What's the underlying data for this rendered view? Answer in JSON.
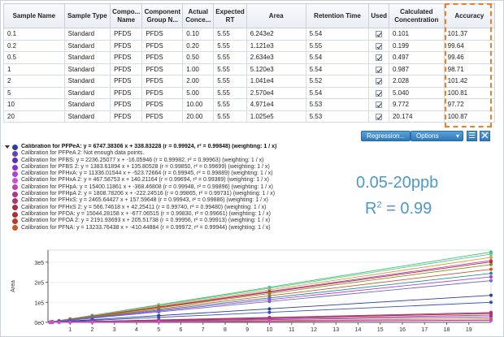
{
  "table": {
    "headers": [
      "Sample Name",
      "Sample Type",
      "Compo...\nName",
      "Component\nGroup N...",
      "Actual\nConce...",
      "Expected\nRT",
      "Area",
      "Retention Time",
      "Used",
      "Calculated\nConcentration",
      "Accuracy"
    ],
    "rows": [
      [
        "0.1",
        "Standard",
        "PFDS",
        "PFDS",
        "0.10",
        "5.55",
        "6.243e2",
        "5.54",
        true,
        "0.101",
        "101.37"
      ],
      [
        "0.2",
        "Standard",
        "PFDS",
        "PFDS",
        "0.20",
        "5.55",
        "1.121e3",
        "5.55",
        true,
        "0.199",
        "99.64"
      ],
      [
        "0.5",
        "Standard",
        "PFDS",
        "PFDS",
        "0.50",
        "5.55",
        "2.634e3",
        "5.54",
        true,
        "0.497",
        "99.46"
      ],
      [
        "1",
        "Standard",
        "PFDS",
        "PFDS",
        "1.00",
        "5.55",
        "5.120e3",
        "5.54",
        true,
        "0.987",
        "98.71"
      ],
      [
        "2",
        "Standard",
        "PFDS",
        "PFDS",
        "2.00",
        "5.55",
        "1.041e4",
        "5.52",
        true,
        "2.028",
        "101.42"
      ],
      [
        "5",
        "Standard",
        "PFDS",
        "PFDS",
        "5.00",
        "5.55",
        "2.570e4",
        "5.54",
        true,
        "5.040",
        "100.81"
      ],
      [
        "10",
        "Standard",
        "PFDS",
        "PFDS",
        "10.00",
        "5.55",
        "4.971e4",
        "5.53",
        true,
        "9.772",
        "97.72"
      ],
      [
        "20",
        "Standard",
        "PFDS",
        "PFDS",
        "20.00",
        "5.55",
        "1.025e5",
        "5.53",
        true,
        "20.174",
        "100.87"
      ]
    ]
  },
  "toolbar": {
    "regression_label": "Regression...",
    "options_label": "Options",
    "options_arrow": "▾",
    "settings_icon": "grid-settings-icon",
    "close_icon": "close-icon"
  },
  "legend": [
    {
      "text": "Calibration for PFPeA: y = 6747.38306 x + 338.83228 (r = 0.99924, r² = 0.99848) (weighting: 1 / x)",
      "color": "#2a3f9e"
    },
    {
      "text": "Calibration for PFPeA 2: Not enough data points.",
      "color": "#6a3fb8"
    },
    {
      "text": "Calibration for PFBS: y = 2236.25077 x + -16.05946 (r = 0.99982, r² = 0.99963) (weighting: 1 / x)",
      "color": "#5b2fc0"
    },
    {
      "text": "Calibration for PFBS 2: y = 1383.61894 x + 135.80528 (r = 0.99850, r² = 0.99699) (weighting: 1 / x)",
      "color": "#8a2fd0"
    },
    {
      "text": "Calibration for PFHxA: y = 11336.01544 x + -523.72664 (r = 0.99945, r² = 0.99889) (weighting: 1 / x)",
      "color": "#b03fd8"
    },
    {
      "text": "Calibration for PFHxA 2: y = 467.58753 x + 140.21164 (r = 0.99694, r² = 0.99389) (weighting: 1 / x)",
      "color": "#d04fd0"
    },
    {
      "text": "Calibration for PFHpA: y = 15400.11861 x + -368.46808 (r = 0.99948, r² = 0.99896) (weighting: 1 / x)",
      "color": "#c040b8"
    },
    {
      "text": "Calibration for PFHpA 2: y = 1808.78206 x + -222.24516 (r = 0.99865, r² = 0.99731) (weighting: 1 / x)",
      "color": "#a83a8a"
    },
    {
      "text": "Calibration for PFHxS: y = 2465.64427 x + 157.59648 (r = 0.99943, r² = 0.99886) (weighting: 1 / x)",
      "color": "#b3356a"
    },
    {
      "text": "Calibration for PFHxS 2: y = 566.74618 x + 42.25411 (r = 0.99740, r² = 0.99480) (weighting: 1 / x)",
      "color": "#a8304a"
    },
    {
      "text": "Calibration for PFOA: y = 15044.28158 x + -677.06515 (r = 0.99830, r² = 0.99661) (weighting: 1 / x)",
      "color": "#b03030"
    },
    {
      "text": "Calibration for PFOA 2: y = 2191.93693 x + 205.51738 (r = 0.99956, r² = 0.99913) (weighting: 1 / x)",
      "color": "#c03a2a"
    },
    {
      "text": "Calibration for PFNA: y = 13233.76438 x + -410.44884 (r = 0.99972, r² = 0.99944) (weighting: 1 / x)",
      "color": "#c85a2a"
    }
  ],
  "overlay": {
    "range": "0.05-20ppb",
    "r2_prefix": "R",
    "r2_sup": "2",
    "r2_value": " = 0.99"
  },
  "chart_data": {
    "type": "scatter",
    "ylabel": "Area",
    "xlim": [
      0,
      20
    ],
    "ylim": [
      0,
      360000
    ],
    "x_ticks": [
      "1",
      "2",
      "3",
      "4",
      "5",
      "6",
      "7",
      "8",
      "9",
      "10",
      "11",
      "12",
      "13",
      "14",
      "15",
      "16",
      "17",
      "18",
      "19"
    ],
    "y_ticks": [
      "0e0",
      "1e5",
      "2e5",
      "3e5"
    ],
    "y_tick_values": [
      0,
      100000,
      200000,
      300000
    ],
    "x_points": [
      0.1,
      0.2,
      0.5,
      1,
      2,
      5,
      10,
      20
    ],
    "series": [
      {
        "slope": 17500,
        "color": "#3cc46a"
      },
      {
        "slope": 17000,
        "color": "#58c8a0"
      },
      {
        "slope": 16200,
        "color": "#e0a030"
      },
      {
        "slope": 15400,
        "color": "#c040b8"
      },
      {
        "slope": 15044,
        "color": "#b03030"
      },
      {
        "slope": 14400,
        "color": "#8a8a20"
      },
      {
        "slope": 13234,
        "color": "#c85a2a"
      },
      {
        "slope": 12200,
        "color": "#2090a0"
      },
      {
        "slope": 11336,
        "color": "#b03fd8"
      },
      {
        "slope": 10400,
        "color": "#6a6ad0"
      },
      {
        "slope": 6747,
        "color": "#2a3f9e"
      },
      {
        "slope": 5000,
        "color": "#3050c0"
      },
      {
        "slope": 2466,
        "color": "#b3356a"
      },
      {
        "slope": 2236,
        "color": "#5b2fc0"
      },
      {
        "slope": 2192,
        "color": "#c03a2a"
      },
      {
        "slope": 1809,
        "color": "#a83a8a"
      },
      {
        "slope": 1384,
        "color": "#8a2fd0"
      },
      {
        "slope": 900,
        "color": "#d08030"
      },
      {
        "slope": 567,
        "color": "#a8304a"
      },
      {
        "slope": 468,
        "color": "#d04fd0"
      }
    ]
  }
}
